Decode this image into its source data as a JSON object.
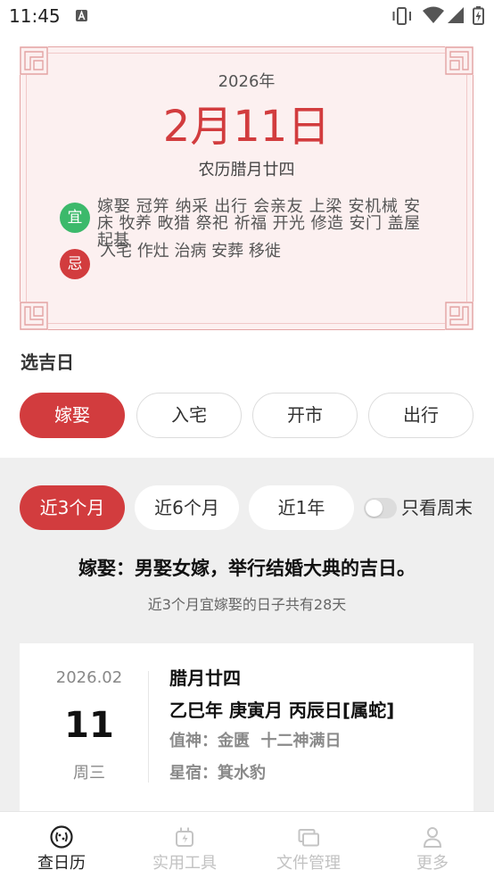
{
  "status_bar": {
    "time": "11:45",
    "icons": [
      "a-notification-icon",
      "vibrate-icon",
      "wifi-icon",
      "signal-icon",
      "battery-charging-icon"
    ]
  },
  "calendar_card": {
    "year": "2026年",
    "date": "2月11日",
    "lunar": "农历腊月廿四",
    "yi": {
      "badge": "宜",
      "text": "嫁娶 冠笄 纳采 出行 会亲友 上梁 安机械 安床 牧养 畋猎 祭祀 祈福 开光 修造 安门 盖屋 起基"
    },
    "ji": {
      "badge": "忌",
      "text": "入宅 作灶 治病 安葬 移徙"
    }
  },
  "select_day": {
    "title": "选吉日",
    "categories": [
      {
        "label": "嫁娶",
        "selected": true
      },
      {
        "label": "入宅",
        "selected": false
      },
      {
        "label": "开市",
        "selected": false
      },
      {
        "label": "出行",
        "selected": false
      }
    ]
  },
  "filter": {
    "periods": [
      {
        "label": "近3个月",
        "selected": true
      },
      {
        "label": "近6个月",
        "selected": false
      },
      {
        "label": "近1年",
        "selected": false
      }
    ],
    "weekend_toggle": {
      "label": "只看周末",
      "on": false
    }
  },
  "description": "嫁娶：男娶女嫁，举行结婚大典的吉日。",
  "summary": "近3个月宜嫁娶的日子共有28天",
  "results": [
    {
      "year_month": "2026.02",
      "day": "11",
      "weekday": "周三",
      "lunar_date": "腊月廿四",
      "ganzhi": "乙巳年 庚寅月 丙辰日[属蛇]",
      "zhishen": "值神：金匮  十二神满日",
      "xingxiu": "星宿：箕水豹"
    }
  ],
  "bottom_nav": [
    {
      "label": "查日历",
      "icon": "calendar-face-icon",
      "active": true
    },
    {
      "label": "实用工具",
      "icon": "tools-charger-icon",
      "active": false
    },
    {
      "label": "文件管理",
      "icon": "files-icon",
      "active": false
    },
    {
      "label": "更多",
      "icon": "person-icon",
      "active": false
    }
  ],
  "colors": {
    "accent_red": "#d23c3e",
    "yi_green": "#3cb96b",
    "card_border": "#e4a4a4",
    "card_bg": "#fcf0f0",
    "section_gray": "#efefef"
  }
}
